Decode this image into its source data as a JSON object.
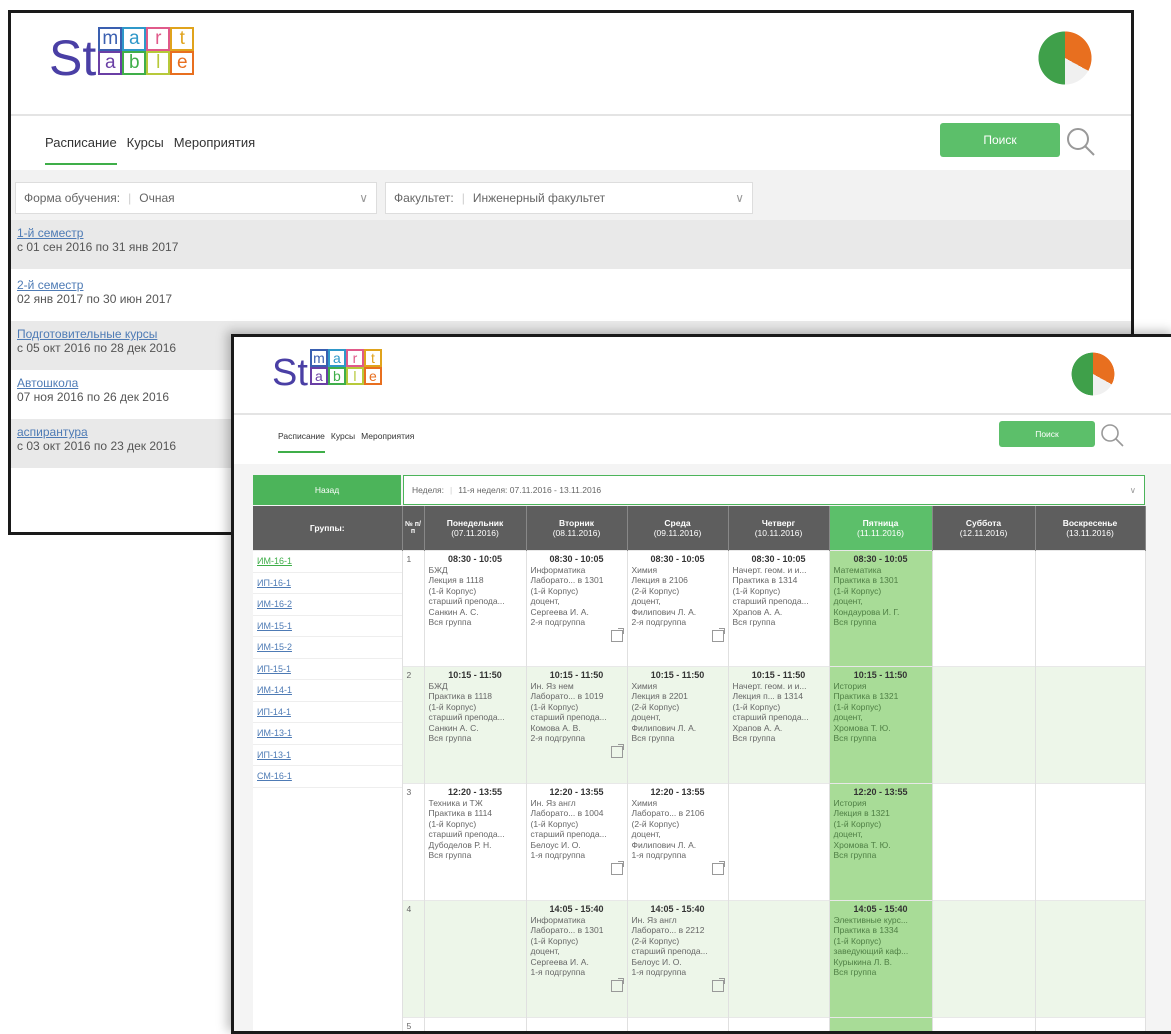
{
  "colors": {
    "accent": "#3fae49",
    "button": "#5cbf6a",
    "header_gray": "#5e5e5e",
    "friday_highlight": "#a8dc97",
    "row_light_green": "#edf6e9"
  },
  "logo": {
    "big": "St",
    "row1": [
      "m",
      "a",
      "r",
      "t"
    ],
    "row2": [
      "a",
      "b",
      "l",
      "e"
    ],
    "mark": "®"
  },
  "back": {
    "nav": {
      "schedule": "Расписание",
      "courses": "Курсы",
      "events": "Мероприятия"
    },
    "search": {
      "label": "Поиск"
    },
    "filters": {
      "form_label": "Форма обучения:",
      "form_value": "Очная",
      "faculty_label": "Факультет:",
      "faculty_value": "Инженерный факультет"
    },
    "semesters": [
      {
        "name": "1-й семестр",
        "dates": "с 01 сен 2016 по 31 янв 2017"
      },
      {
        "name": "2-й семестр",
        "dates": "02 янв 2017 по 30 июн 2017"
      },
      {
        "name": "Подготовительные курсы",
        "dates": "с 05 окт 2016 по 28 дек 2016"
      },
      {
        "name": "Автошкола",
        "dates": "07 ноя 2016 по 26 дек 2016"
      },
      {
        "name": "аспирантура",
        "dates": "с 03 окт 2016 по 23 дек 2016"
      }
    ]
  },
  "front": {
    "nav": {
      "schedule": "Расписание",
      "courses": "Курсы",
      "events": "Мероприятия"
    },
    "search": {
      "label": "Поиск"
    },
    "back_button": "Назад",
    "week_label": "Неделя:",
    "week_value": "11-я неделя: 07.11.2016 - 13.11.2016",
    "groups_header": "Группы:",
    "num_header": "№ п/п",
    "days": [
      {
        "name": "Понедельник",
        "date": "(07.11.2016)"
      },
      {
        "name": "Вторник",
        "date": "(08.11.2016)"
      },
      {
        "name": "Среда",
        "date": "(09.11.2016)"
      },
      {
        "name": "Четверг",
        "date": "(10.11.2016)"
      },
      {
        "name": "Пятница",
        "date": "(11.11.2016)"
      },
      {
        "name": "Суббота",
        "date": "(12.11.2016)"
      },
      {
        "name": "Воскресенье",
        "date": "(13.11.2016)"
      }
    ],
    "groups": [
      "ИМ-16-1",
      "ИП-16-1",
      "ИМ-16-2",
      "ИМ-15-1",
      "ИМ-15-2",
      "ИП-15-1",
      "ИМ-14-1",
      "ИП-14-1",
      "ИМ-13-1",
      "ИП-13-1",
      "СМ-16-1"
    ],
    "rows": [
      {
        "n": "1",
        "cells": [
          {
            "time": "08:30 - 10:05",
            "lines": [
              "БЖД",
              "Лекция в 1118",
              "(1-й Корпус)",
              "старший препода...",
              "Санкин А. С.",
              "Вся группа"
            ]
          },
          {
            "time": "08:30 - 10:05",
            "lines": [
              "Информатика",
              "Лаборато... в 1301",
              "(1-й Корпус)",
              "доцент,",
              "Сергеева И. А.",
              "2-я подгруппа"
            ],
            "ext": true
          },
          {
            "time": "08:30 - 10:05",
            "lines": [
              "Химия",
              "Лекция в 2106",
              "(2-й Корпус)",
              "доцент,",
              "Филипович Л. А.",
              "2-я подгруппа"
            ],
            "ext": true
          },
          {
            "time": "08:30 - 10:05",
            "lines": [
              "Начерт. геом. и и...",
              "Практика в 1314",
              "(1-й Корпус)",
              "старший препода...",
              "Храпов А. А.",
              "Вся группа"
            ]
          },
          {
            "time": "08:30 - 10:05",
            "lines": [
              "Математика",
              "Практика в 1301",
              "(1-й Корпус)",
              "доцент,",
              "Кондаурова И. Г.",
              "Вся группа"
            ]
          },
          null,
          null
        ]
      },
      {
        "n": "2",
        "cells": [
          {
            "time": "10:15 - 11:50",
            "lines": [
              "БЖД",
              "Практика в 1118",
              "(1-й Корпус)",
              "старший препода...",
              "Санкин А. С.",
              "Вся группа"
            ]
          },
          {
            "time": "10:15 - 11:50",
            "lines": [
              "Ин. Яз нем",
              "Лаборато... в 1019",
              "(1-й Корпус)",
              "старший препода...",
              "Комова А. В.",
              "2-я подгруппа"
            ],
            "ext": true
          },
          {
            "time": "10:15 - 11:50",
            "lines": [
              "Химия",
              "Лекция в 2201",
              "(2-й Корпус)",
              "доцент,",
              "Филипович Л. А.",
              "Вся группа"
            ]
          },
          {
            "time": "10:15 - 11:50",
            "lines": [
              "Начерт. геом. и и...",
              "Лекция п... в 1314",
              "(1-й Корпус)",
              "старший препода...",
              "Храпов А. А.",
              "Вся группа"
            ]
          },
          {
            "time": "10:15 - 11:50",
            "lines": [
              "История",
              "Практика в 1321",
              "(1-й Корпус)",
              "доцент,",
              "Хромова Т. Ю.",
              "Вся группа"
            ]
          },
          null,
          null
        ]
      },
      {
        "n": "3",
        "cells": [
          {
            "time": "12:20 - 13:55",
            "lines": [
              "Техника и ТЖ",
              "Практика в 1114",
              "(1-й Корпус)",
              "старший препода...",
              "Дубоделов Р. Н.",
              "Вся группа"
            ]
          },
          {
            "time": "12:20 - 13:55",
            "lines": [
              "Ин. Яз англ",
              "Лаборато... в 1004",
              "(1-й Корпус)",
              "старший препода...",
              "Белоус И. О.",
              "1-я подгруппа"
            ],
            "ext": true
          },
          {
            "time": "12:20 - 13:55",
            "lines": [
              "Химия",
              "Лаборато... в 2106",
              "(2-й Корпус)",
              "доцент,",
              "Филипович Л. А.",
              "1-я подгруппа"
            ],
            "ext": true
          },
          null,
          {
            "time": "12:20 - 13:55",
            "lines": [
              "История",
              "Лекция в 1321",
              "(1-й Корпус)",
              "доцент,",
              "Хромова Т. Ю.",
              "Вся группа"
            ]
          },
          null,
          null
        ]
      },
      {
        "n": "4",
        "cells": [
          null,
          {
            "time": "14:05 - 15:40",
            "lines": [
              "Информатика",
              "Лаборато... в 1301",
              "(1-й Корпус)",
              "доцент,",
              "Сергеева И. А.",
              "1-я подгруппа"
            ],
            "ext": true
          },
          {
            "time": "14:05 - 15:40",
            "lines": [
              "Ин. Яз англ",
              "Лаборато... в 2212",
              "(2-й Корпус)",
              "старший препода...",
              "Белоус И. О.",
              "1-я подгруппа"
            ],
            "ext": true
          },
          null,
          {
            "time": "14:05 - 15:40",
            "lines": [
              "Элективные курс...",
              "Практика в 1334",
              "(1-й Корпус)",
              "заведующий каф...",
              "Курыкина Л. В.",
              "Вся группа"
            ]
          },
          null,
          null
        ]
      },
      {
        "n": "5",
        "cells": [
          null,
          null,
          null,
          null,
          null,
          null,
          null
        ]
      }
    ]
  }
}
